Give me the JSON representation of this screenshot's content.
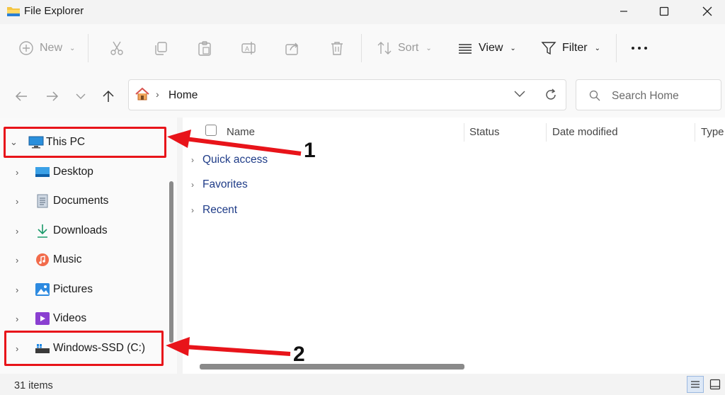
{
  "window": {
    "title": "File Explorer",
    "app_icon": "folder-icon",
    "controls": [
      "minimize-icon",
      "maximize-icon",
      "close-icon"
    ]
  },
  "toolbar": {
    "new_label": "New",
    "sort_label": "Sort",
    "view_label": "View",
    "filter_label": "Filter",
    "icons": [
      "cut-icon",
      "copy-icon",
      "paste-icon",
      "rename-icon",
      "share-icon",
      "delete-icon",
      "more-icon"
    ]
  },
  "address": {
    "path_label": "Home",
    "home_icon": "home-icon",
    "search_placeholder": "Search Home"
  },
  "navigation": {
    "this_pc": "This PC",
    "items": [
      {
        "label": "Desktop",
        "icon": "desktop-folder-icon"
      },
      {
        "label": "Documents",
        "icon": "documents-icon"
      },
      {
        "label": "Downloads",
        "icon": "downloads-icon"
      },
      {
        "label": "Music",
        "icon": "music-icon"
      },
      {
        "label": "Pictures",
        "icon": "pictures-icon"
      },
      {
        "label": "Videos",
        "icon": "videos-icon"
      },
      {
        "label": "Windows-SSD (C:)",
        "icon": "drive-icon"
      }
    ]
  },
  "content": {
    "columns": [
      "Name",
      "Status",
      "Date modified",
      "Type"
    ],
    "groups": [
      "Quick access",
      "Favorites",
      "Recent"
    ]
  },
  "status": {
    "item_count": "31 items"
  },
  "annotations": {
    "label_1": "1",
    "label_2": "2",
    "color": "#e8141a"
  },
  "colors": {
    "accent": "#0067c0",
    "link_text": "#1f3c88"
  }
}
